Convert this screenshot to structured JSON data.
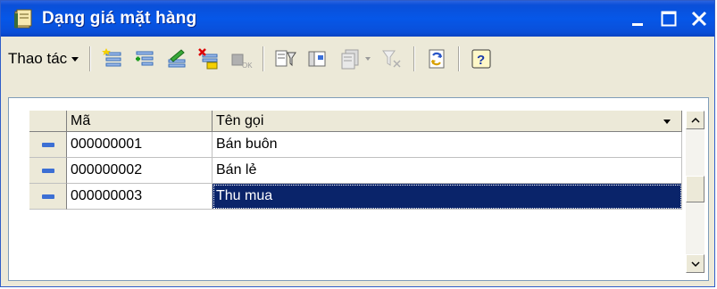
{
  "window": {
    "title": "Dạng giá mặt hàng",
    "colors": {
      "titlebar": "#0657e8",
      "selection": "#0a246a",
      "face": "#ece9d8"
    }
  },
  "toolbar": {
    "menu_label": "Thao tác",
    "icons": [
      "add-record-icon",
      "add-child-icon",
      "edit-icon",
      "delete-icon",
      "ok-icon",
      "filter-icon",
      "form-icon",
      "copy-dropdown-icon",
      "clear-filter-icon",
      "refresh-icon",
      "help-icon"
    ]
  },
  "grid": {
    "columns": [
      "Mã",
      "Tên gọi"
    ],
    "rows": [
      {
        "code": "000000001",
        "name": "Bán buôn"
      },
      {
        "code": "000000002",
        "name": "Bán lẻ"
      },
      {
        "code": "000000003",
        "name": "Thu mua"
      }
    ],
    "selected_index": 2
  }
}
